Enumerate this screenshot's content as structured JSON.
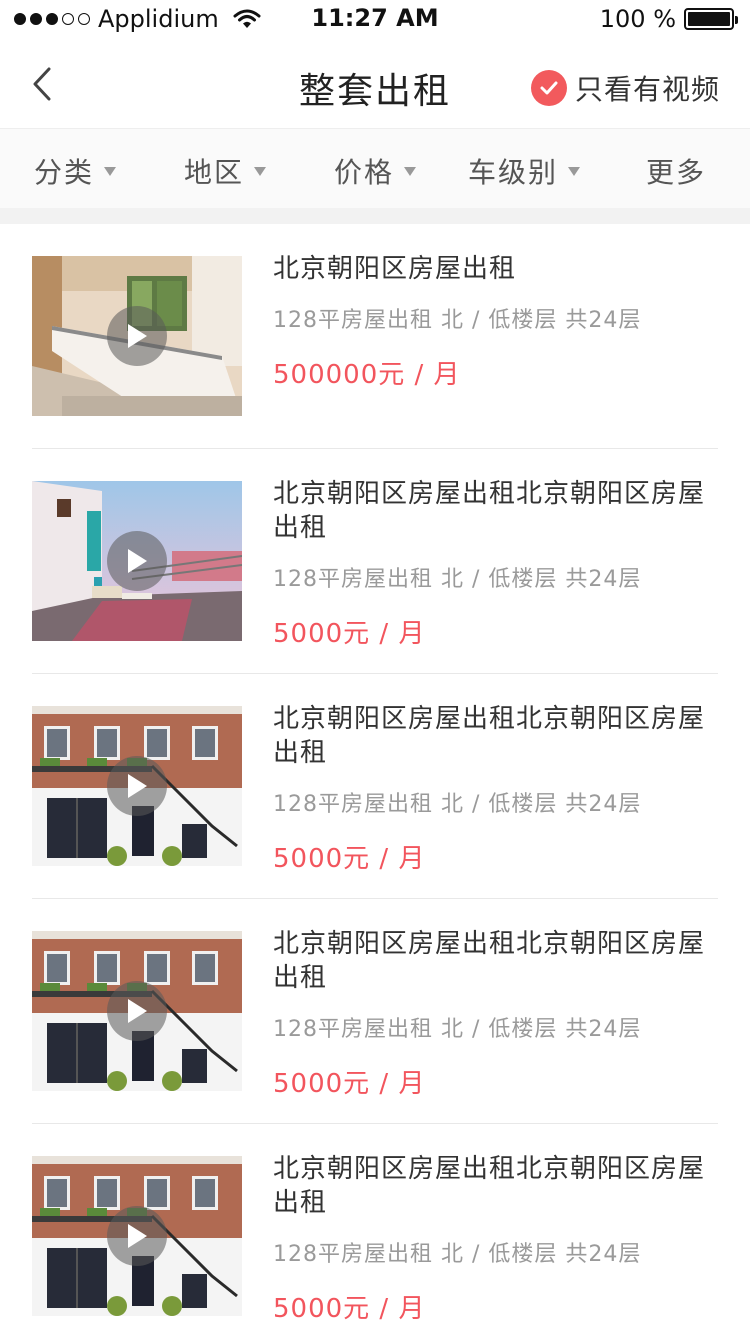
{
  "status_bar": {
    "carrier": "Applidium",
    "time": "11:27 AM",
    "battery_text": "100 %"
  },
  "nav": {
    "back_icon": "chevron-left-icon",
    "title": "整套出租",
    "video_filter_label": "只看有视频",
    "accent_color": "#f25a5d"
  },
  "filters": [
    {
      "label": "分类",
      "has_caret": true
    },
    {
      "label": "地区",
      "has_caret": true
    },
    {
      "label": "价格",
      "has_caret": true
    },
    {
      "label": "车级别",
      "has_caret": true
    },
    {
      "label": "更多",
      "has_caret": false
    }
  ],
  "listings": [
    {
      "title": "北京朝阳区房屋出租",
      "meta": "128平房屋出租 北 / 低楼层 共24层",
      "price": "500000元 / 月",
      "image": "kitchen"
    },
    {
      "title": "北京朝阳区房屋出租北京朝阳区房屋出租",
      "meta": "128平房屋出租 北 / 低楼层 共24层",
      "price": "5000元 / 月",
      "image": "terrace"
    },
    {
      "title": "北京朝阳区房屋出租北京朝阳区房屋出租",
      "meta": "128平房屋出租 北 / 低楼层 共24层",
      "price": "5000元 / 月",
      "image": "brick-house"
    },
    {
      "title": "北京朝阳区房屋出租北京朝阳区房屋出租",
      "meta": "128平房屋出租 北 / 低楼层 共24层",
      "price": "5000元 / 月",
      "image": "brick-house"
    },
    {
      "title": "北京朝阳区房屋出租北京朝阳区房屋出租",
      "meta": "128平房屋出租 北 / 低楼层 共24层",
      "price": "5000元 / 月",
      "image": "brick-house"
    }
  ],
  "price_color": "#f2555d"
}
